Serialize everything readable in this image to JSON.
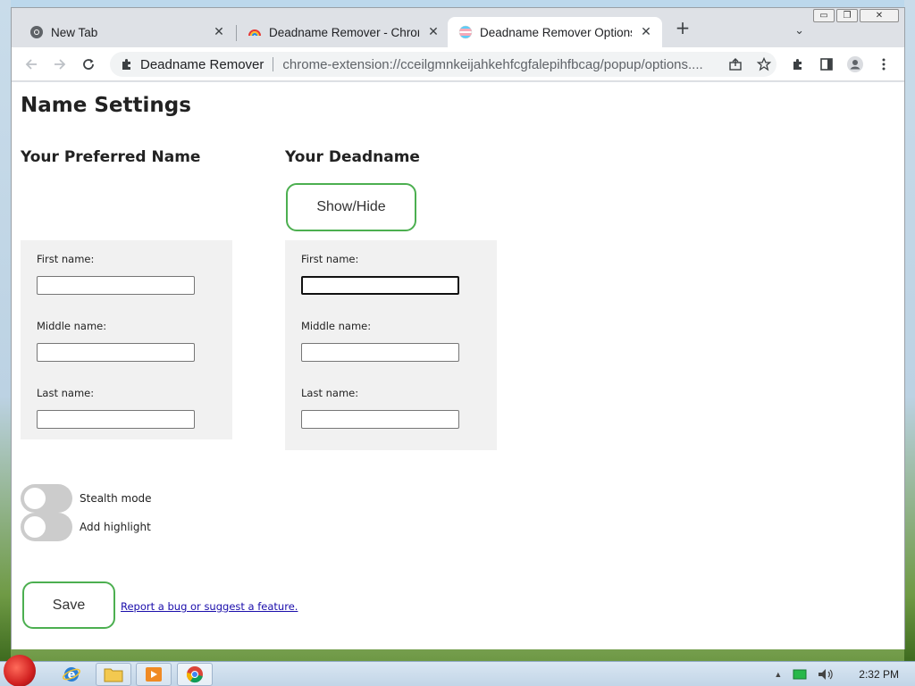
{
  "browser": {
    "tabs": [
      {
        "title": "New Tab",
        "icon": "chrome-icon",
        "active": false
      },
      {
        "title": "Deadname Remover - Chrome",
        "icon": "extension-rainbow-icon",
        "active": false
      },
      {
        "title": "Deadname Remover Options",
        "icon": "trans-flag-icon",
        "active": true
      }
    ],
    "new_tab_symbol": "+",
    "tab_search_symbol": "⌄",
    "omnibox": {
      "extension_name": "Deadname Remover",
      "url": "chrome-extension://cceilgmnkeijahkehfcgfalepihfbcag/popup/options...."
    },
    "window_controls": {
      "minimize": "▭",
      "restore": "❐",
      "close": "✕"
    }
  },
  "page": {
    "title": "Name Settings",
    "preferred": {
      "heading": "Your Preferred Name",
      "fields": [
        {
          "label": "First name:",
          "value": ""
        },
        {
          "label": "Middle name:",
          "value": ""
        },
        {
          "label": "Last name:",
          "value": ""
        }
      ]
    },
    "deadname": {
      "heading": "Your Deadname",
      "show_hide_label": "Show/Hide",
      "fields": [
        {
          "label": "First name:",
          "value": "",
          "focused": true
        },
        {
          "label": "Middle name:",
          "value": ""
        },
        {
          "label": "Last name:",
          "value": ""
        }
      ]
    },
    "toggles": [
      {
        "label": "Stealth mode",
        "on": false
      },
      {
        "label": "Add highlight",
        "on": false
      }
    ],
    "save_label": "Save",
    "report_link": "Report a bug or suggest a feature."
  },
  "taskbar": {
    "clock": "2:32 PM",
    "tray_arrow": "▲"
  },
  "colors": {
    "accent_green": "#4caf50",
    "panel_gray": "#f1f1f1",
    "toggle_off": "#cccccc",
    "link": "#1a0dab"
  }
}
